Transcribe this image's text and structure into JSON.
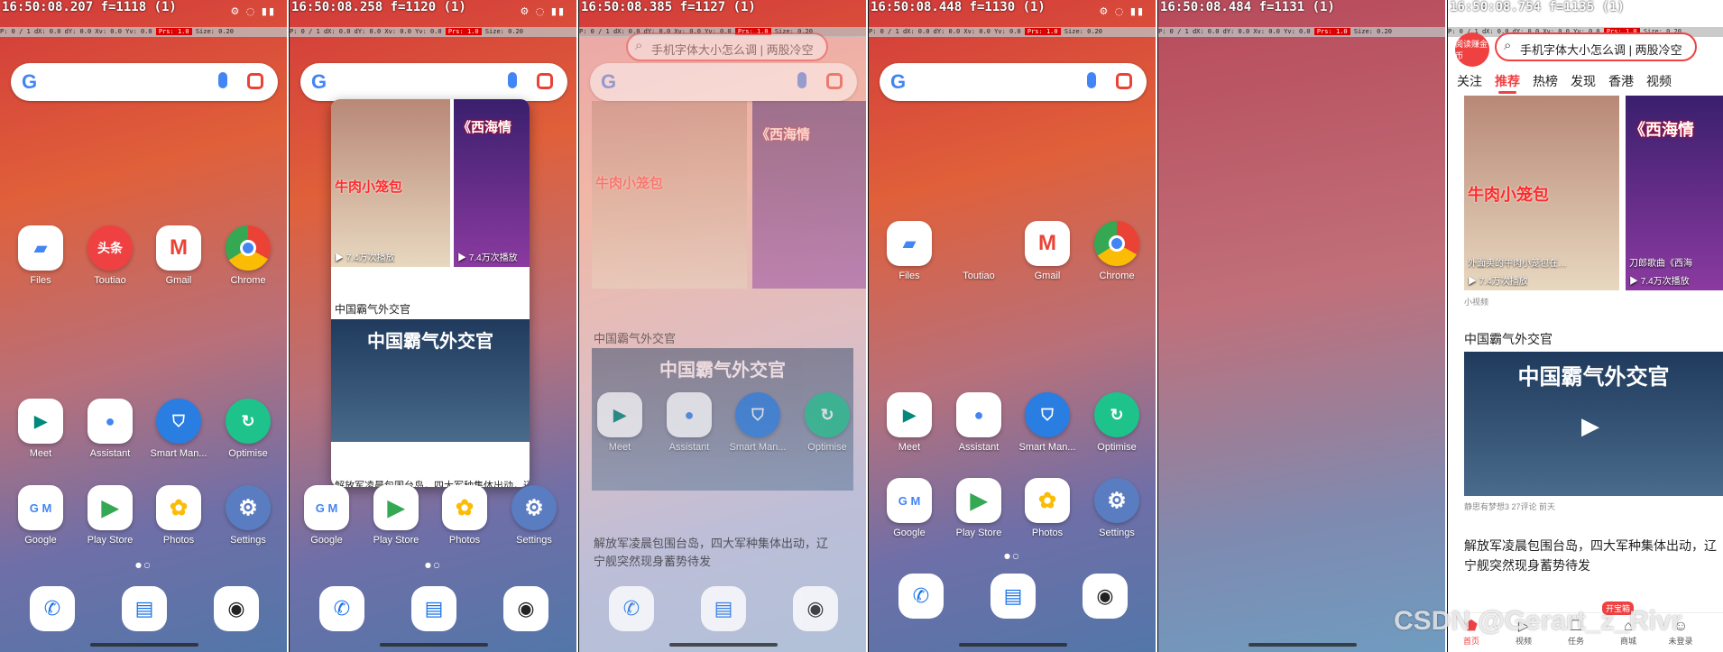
{
  "panels": [
    {
      "clock": "16:50:08.207 f=1118 (1)"
    },
    {
      "clock": "16:50:08.258 f=1120 (1)"
    },
    {
      "clock": "16:50:08.385 f=1127 (1)"
    },
    {
      "clock": "16:50:08.448 f=1130 (1)"
    },
    {
      "clock": "16:50:08.484 f=1131 (1)"
    },
    {
      "clock": "16:50:08.754 f=1135 (1)"
    }
  ],
  "debug": {
    "p": "P: 0 / 1",
    "dx": "dX: 0.0",
    "dy": "dY: 0.0",
    "xv": "Xv: 0.0",
    "yv": "Yv: 0.0",
    "prs": "Prs: 1.0",
    "size": "Size: 0.20"
  },
  "search": {
    "logo": "G"
  },
  "apps": {
    "files": "Files",
    "toutiao": "Toutiao",
    "gmail": "Gmail",
    "chrome": "Chrome",
    "meet": "Meet",
    "assistant": "Assistant",
    "smart_manager": "Smart Man...",
    "optimise": "Optimise",
    "google": "Google",
    "play_store": "Play Store",
    "photos": "Photos",
    "settings": "Settings",
    "toutiao_icon_text": "头条"
  },
  "news": {
    "search_text": "手机字体大小怎么调 | 两股冷空",
    "logo_text": "阅读赚金币",
    "tabs": [
      "关注",
      "推荐",
      "热榜",
      "发现",
      "香港",
      "视频"
    ],
    "active_tab": "推荐",
    "video1_overlay": "牛肉小笼包",
    "video1_caption": "外面卖的牛肉小笼包在…",
    "video1_views": "▶ 7.4万次播放",
    "video2_overlay": "《西海情",
    "video2_caption": "刀郎歌曲《西海",
    "video2_views": "▶ 7.4万次播放",
    "section_tag": "小视频",
    "article1_title": "中国霸气外交官",
    "video3_overlay": "中国霸气外交官",
    "article1_meta": "静思有梦想3  27评论  前天",
    "article2_title_line1": "解放军凌晨包围台岛，四大军种集体出动，辽",
    "article2_title_line2": "宁舰突然现身蓄势待发",
    "badge": "开宝箱",
    "nav": [
      "首页",
      "视频",
      "任务",
      "商城",
      "未登录"
    ]
  },
  "watermark": "CSDN @Gerart_z_Rivr"
}
